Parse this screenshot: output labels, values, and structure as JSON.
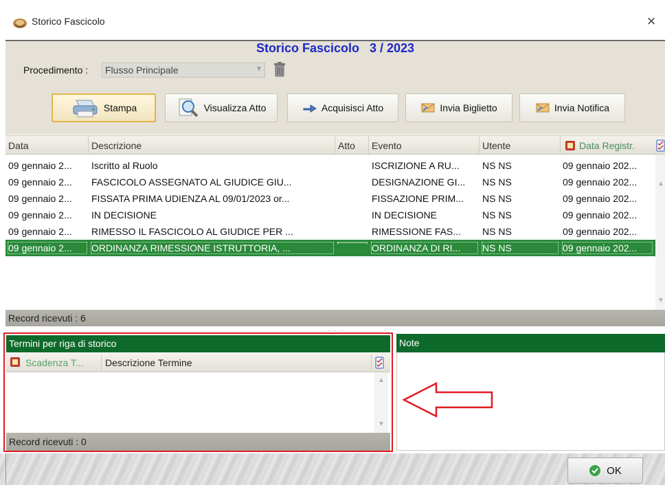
{
  "window": {
    "title": "Storico Fascicolo",
    "close_glyph": "×"
  },
  "header": {
    "title": "Storico Fascicolo   3 / 2023",
    "procedimento_label": "Procedimento :",
    "procedimento_value": "Flusso Principale"
  },
  "toolbar": {
    "stampa": "Stampa",
    "visualizza": "Visualizza Atto",
    "acquisisci": "Acquisisci Atto",
    "invia_biglietto": "Invia Biglietto",
    "invia_notifica": "Invia Notifica"
  },
  "grid": {
    "columns": [
      "Data",
      "Descrizione",
      "Atto",
      "Evento",
      "Utente",
      "Data Registr."
    ],
    "rows": [
      {
        "data": "09 gennaio 2...",
        "descrizione": "Iscritto al Ruolo",
        "atto": "",
        "evento": "ISCRIZIONE A RU...",
        "utente": "NS NS",
        "registr": "09 gennaio 202..."
      },
      {
        "data": "09 gennaio 2...",
        "descrizione": "FASCICOLO ASSEGNATO AL GIUDICE GIU...",
        "atto": "",
        "evento": "DESIGNAZIONE GI...",
        "utente": "NS NS",
        "registr": "09 gennaio 202..."
      },
      {
        "data": "09 gennaio 2...",
        "descrizione": "FISSATA  PRIMA UDIENZA AL 09/01/2023 or...",
        "atto": "",
        "evento": "FISSAZIONE PRIM...",
        "utente": "NS NS",
        "registr": "09 gennaio 202..."
      },
      {
        "data": "09 gennaio 2...",
        "descrizione": "IN DECISIONE",
        "atto": "",
        "evento": "IN DECISIONE",
        "utente": "NS NS",
        "registr": "09 gennaio 202..."
      },
      {
        "data": "09 gennaio 2...",
        "descrizione": "RIMESSO IL FASCICOLO AL GIUDICE PER ...",
        "atto": "",
        "evento": "RIMESSIONE FAS...",
        "utente": "NS NS",
        "registr": "09 gennaio 202..."
      },
      {
        "data": "09 gennaio 2...",
        "descrizione": "ORDINANZA RIMESSIONE ISTRUTTORIA, ...",
        "atto": "",
        "evento": "ORDINANZA DI RI...",
        "utente": "NS NS",
        "registr": "09 gennaio 202..."
      }
    ],
    "selected_row": 5,
    "record_text": "Record ricevuti : 6"
  },
  "termini": {
    "header": "Termini per riga di storico",
    "columns": [
      "Scadenza T...",
      "Descrizione Termine"
    ],
    "record_text": "Record ricevuti : 0"
  },
  "note": {
    "header": "Note"
  },
  "footer": {
    "ok": "OK"
  },
  "colors": {
    "accent_green": "#0e6a2b",
    "selected_row": "#2a8a3a",
    "highlight_red": "#e01a24",
    "title_blue": "#1a27c8"
  },
  "icons": [
    "app-icon",
    "trash-icon",
    "printer-icon",
    "magnifier-icon",
    "arrow-icon",
    "envelope-icon",
    "note-col-icon",
    "checklist-icon",
    "ok-check-icon"
  ]
}
